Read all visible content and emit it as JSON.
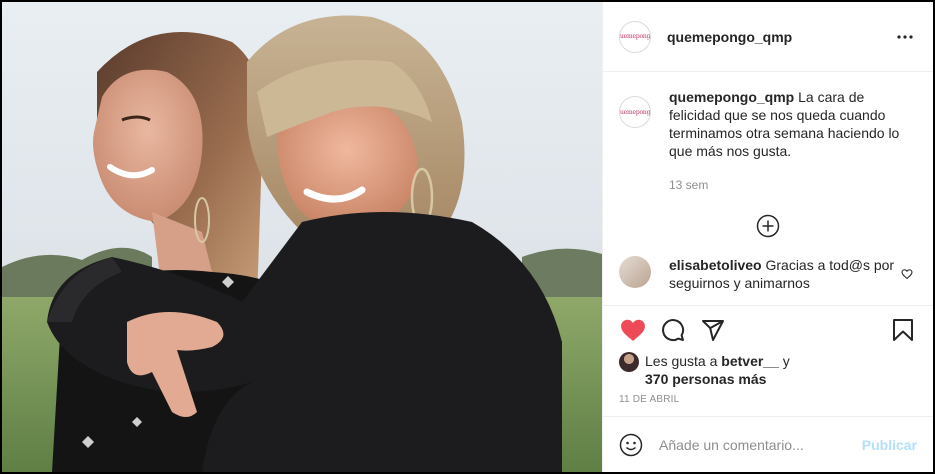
{
  "colors": {
    "like": "#ed4956",
    "link": "#0095f6",
    "muted": "#8e8e8e",
    "border": "#efefef"
  },
  "photo": {
    "alt": ""
  },
  "account": {
    "username": "quemepongo_qmp",
    "avatar_logo": "quemepongo"
  },
  "header": {
    "more_icon": "more-horizontal-icon"
  },
  "caption": {
    "username": "quemepongo_qmp",
    "text": "La cara de felicidad que se nos queda cuando terminamos otra semana haciendo lo que más nos gusta.",
    "time": "13 sem"
  },
  "load_more": {
    "icon": "plus-circle-icon"
  },
  "comments": [
    {
      "username": "elisabetoliveo",
      "text": "Gracias a tod@s por seguirnos y animarnos"
    }
  ],
  "actions": {
    "like_icon": "heart-filled-icon",
    "comment_icon": "comment-icon",
    "share_icon": "paper-plane-icon",
    "save_icon": "bookmark-icon"
  },
  "likes": {
    "prefix": "Les gusta a",
    "user": "betver__",
    "conj": "y",
    "others": "370 personas más"
  },
  "date": "11 DE ABRIL",
  "add_comment": {
    "placeholder": "Añade un comentario...",
    "post_label": "Publicar"
  }
}
